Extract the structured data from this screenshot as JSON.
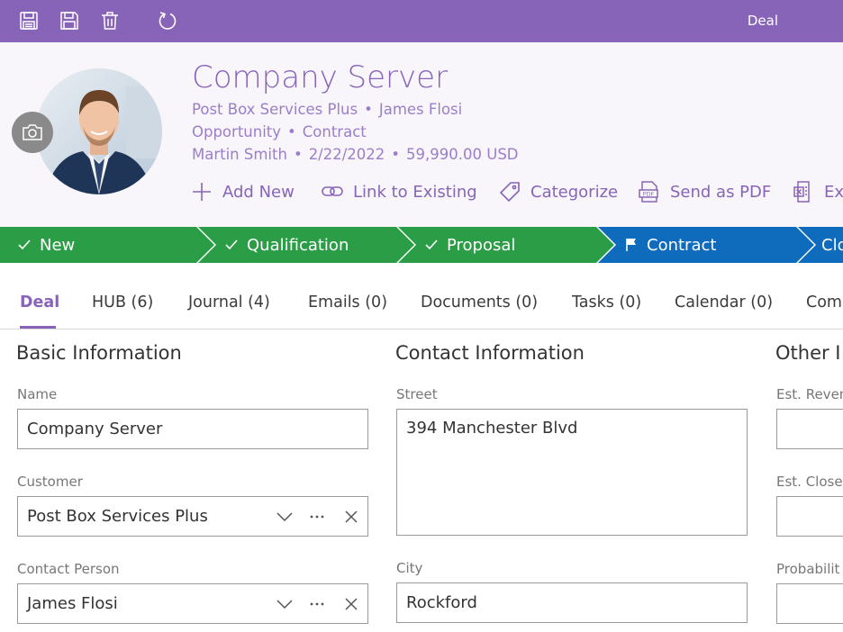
{
  "window": {
    "title": "Deal"
  },
  "toolbar": {
    "icons": [
      "save-close-icon",
      "save-icon",
      "delete-icon",
      "refresh-icon"
    ]
  },
  "header": {
    "title": "Company Server",
    "line1": {
      "customer": "Post Box Services Plus",
      "sep": "•",
      "contact": "James Flosi"
    },
    "line2": {
      "type": "Opportunity",
      "sep": "•",
      "stage": "Contract"
    },
    "line3": {
      "owner": "Martin Smith",
      "sep1": "•",
      "date": "2/22/2022",
      "sep2": "•",
      "amount": "59,990.00 USD"
    },
    "actions": [
      {
        "label": "Add New",
        "icon": "plus-icon"
      },
      {
        "label": "Link to Existing",
        "icon": "link-icon"
      },
      {
        "label": "Categorize",
        "icon": "tag-icon"
      },
      {
        "label": "Send as PDF",
        "icon": "pdf-icon"
      },
      {
        "label": "Ex",
        "icon": "export-icon"
      }
    ]
  },
  "stages": [
    {
      "label": "New",
      "state": "done",
      "color": "#2a9d46"
    },
    {
      "label": "Qualification",
      "state": "done",
      "color": "#2a9d46"
    },
    {
      "label": "Proposal",
      "state": "done",
      "color": "#2a9d46"
    },
    {
      "label": "Contract",
      "state": "current",
      "color": "#0f6cbd"
    },
    {
      "label": "Clo",
      "state": "pending",
      "color": "#0f6cbd"
    }
  ],
  "tabs": [
    {
      "label": "Deal",
      "active": true
    },
    {
      "label": "HUB (6)"
    },
    {
      "label": "Journal (4)"
    },
    {
      "label": "Emails (0)"
    },
    {
      "label": "Documents (0)"
    },
    {
      "label": "Tasks (0)"
    },
    {
      "label": "Calendar (0)"
    },
    {
      "label": "Com"
    }
  ],
  "sections": {
    "basic": {
      "title": "Basic Information",
      "name_label": "Name",
      "name_value": "Company Server",
      "customer_label": "Customer",
      "customer_value": "Post Box Services Plus",
      "contact_label": "Contact Person",
      "contact_value": "James Flosi"
    },
    "contact": {
      "title": "Contact Information",
      "street_label": "Street",
      "street_value": "394 Manchester Blvd",
      "city_label": "City",
      "city_value": "Rockford"
    },
    "other": {
      "title": "Other I",
      "revenue_label": "Est. Reven",
      "close_label": "Est. Close",
      "probability_label": "Probabilit"
    }
  },
  "colors": {
    "accent": "#8764b8",
    "done": "#2a9d46",
    "current": "#0f6cbd"
  }
}
